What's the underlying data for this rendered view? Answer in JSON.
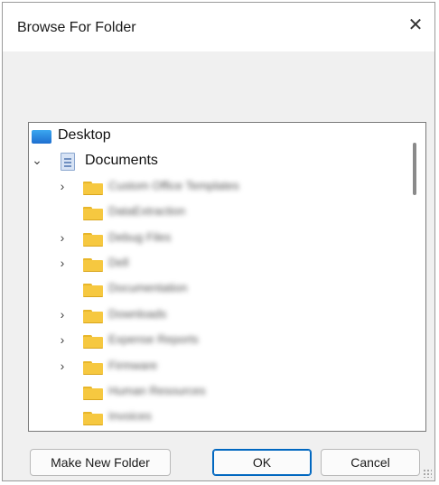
{
  "window": {
    "title": "Browse For Folder",
    "close_glyph": "✕"
  },
  "tree": {
    "items": [
      {
        "label": "Desktop",
        "icon": "desktop-icon",
        "expander": "",
        "level": 0,
        "blurred": false
      },
      {
        "label": "Documents",
        "icon": "documents-icon",
        "expander": "⌄",
        "level": 0,
        "blurred": false
      },
      {
        "label": "Custom Office Templates",
        "icon": "folder-icon",
        "expander": "›",
        "level": 1,
        "blurred": true
      },
      {
        "label": "DataExtraction",
        "icon": "folder-icon",
        "expander": "",
        "level": 1,
        "blurred": true
      },
      {
        "label": "Debug Files",
        "icon": "folder-icon",
        "expander": "›",
        "level": 1,
        "blurred": true
      },
      {
        "label": "Dell",
        "icon": "folder-icon",
        "expander": "›",
        "level": 1,
        "blurred": true
      },
      {
        "label": "Documentation",
        "icon": "folder-icon",
        "expander": "",
        "level": 1,
        "blurred": true
      },
      {
        "label": "Downloads",
        "icon": "folder-icon",
        "expander": "›",
        "level": 1,
        "blurred": true
      },
      {
        "label": "Expense Reports",
        "icon": "folder-icon",
        "expander": "›",
        "level": 1,
        "blurred": true
      },
      {
        "label": "Firmware",
        "icon": "folder-icon",
        "expander": "›",
        "level": 1,
        "blurred": true
      },
      {
        "label": "Human Resources",
        "icon": "folder-icon",
        "expander": "",
        "level": 1,
        "blurred": true
      },
      {
        "label": "Invoices",
        "icon": "folder-icon",
        "expander": "",
        "level": 1,
        "blurred": true
      }
    ]
  },
  "buttons": {
    "make_new_folder": "Make New Folder",
    "ok": "OK",
    "cancel": "Cancel"
  },
  "colors": {
    "accent": "#0067c0",
    "folder": "#f6c840",
    "dialog_bg": "#f0f0f0"
  }
}
